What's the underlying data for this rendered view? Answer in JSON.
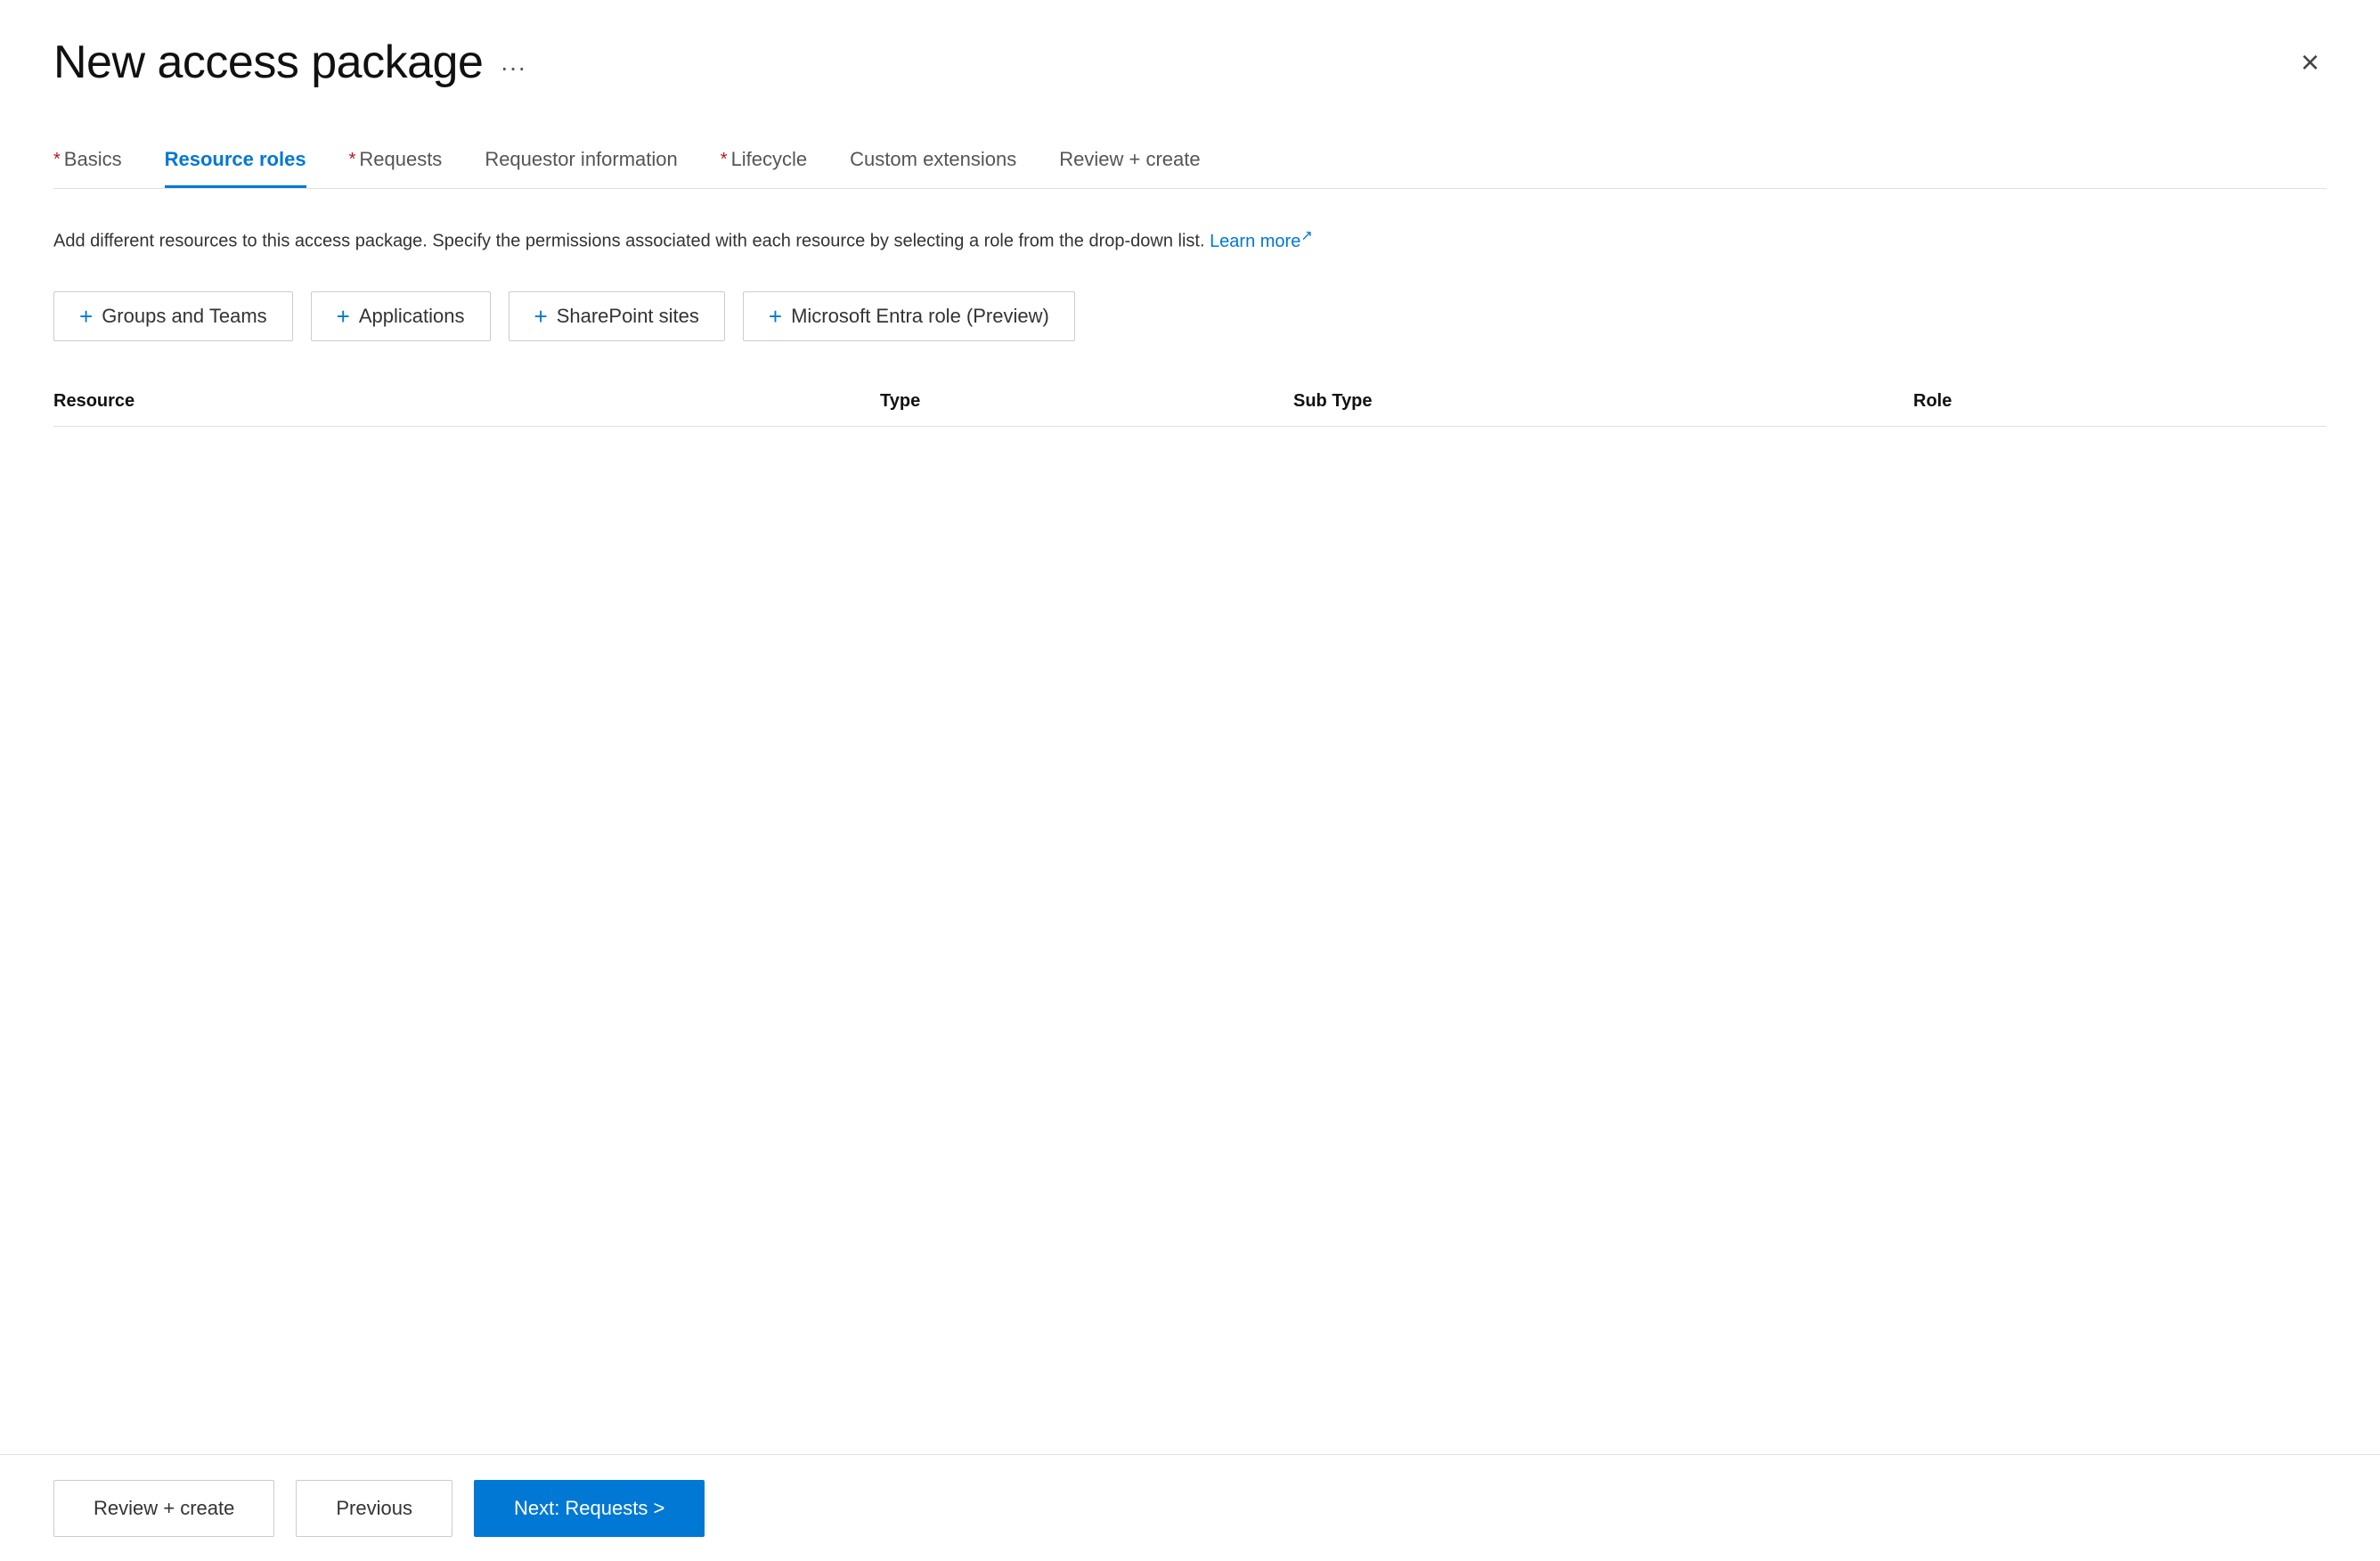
{
  "page": {
    "title": "New access package",
    "more_label": "...",
    "close_label": "×"
  },
  "tabs": [
    {
      "id": "basics",
      "label": "Basics",
      "required": true,
      "active": false
    },
    {
      "id": "resource-roles",
      "label": "Resource roles",
      "required": false,
      "active": true
    },
    {
      "id": "requests",
      "label": "Requests",
      "required": true,
      "active": false
    },
    {
      "id": "requestor-info",
      "label": "Requestor information",
      "required": false,
      "active": false
    },
    {
      "id": "lifecycle",
      "label": "Lifecycle",
      "required": true,
      "active": false
    },
    {
      "id": "custom-extensions",
      "label": "Custom extensions",
      "required": false,
      "active": false
    },
    {
      "id": "review-create",
      "label": "Review + create",
      "required": false,
      "active": false
    }
  ],
  "description": {
    "text": "Add different resources to this access package. Specify the permissions associated with each resource by selecting a role from the drop-down list.",
    "link_text": "Learn more",
    "link_icon": "↗"
  },
  "resource_buttons": [
    {
      "id": "groups-teams",
      "label": "Groups and Teams"
    },
    {
      "id": "applications",
      "label": "Applications"
    },
    {
      "id": "sharepoint-sites",
      "label": "SharePoint sites"
    },
    {
      "id": "entra-role",
      "label": "Microsoft Entra role (Preview)"
    }
  ],
  "table": {
    "columns": [
      {
        "id": "resource",
        "label": "Resource"
      },
      {
        "id": "type",
        "label": "Type"
      },
      {
        "id": "sub-type",
        "label": "Sub Type"
      },
      {
        "id": "role",
        "label": "Role"
      }
    ]
  },
  "footer": {
    "review_create_label": "Review + create",
    "previous_label": "Previous",
    "next_label": "Next: Requests >"
  }
}
